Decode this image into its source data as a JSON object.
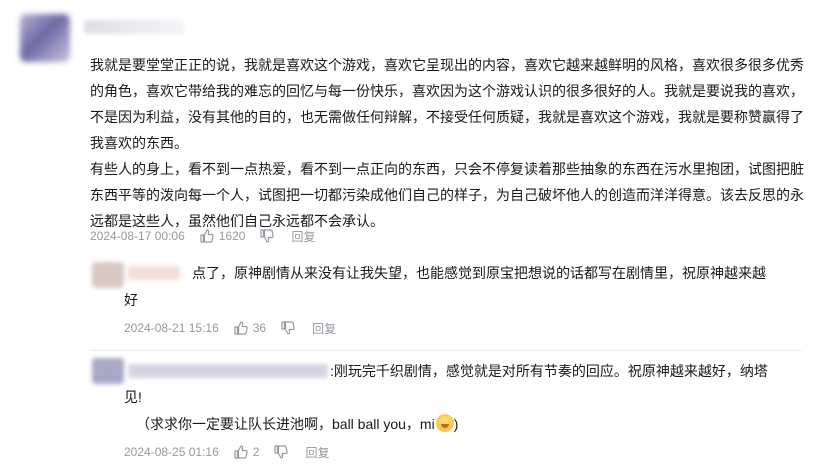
{
  "main_comment": {
    "paragraphs": [
      "我就是要堂堂正正的说，我就是喜欢这个游戏，喜欢它呈现出的内容，喜欢它越来越鲜明的风格，喜欢很多很多优秀的角色，喜欢它带给我的难忘的回忆与每一份快乐，喜欢因为这个游戏认识的很多很好的人。我就是要说我的喜欢，不是因为利益，没有其他的目的，也无需做任何辩解，不接受任何质疑，我就是喜欢这个游戏，我就是要称赞赢得了我喜欢的东西。",
      "有些人的身上，看不到一点热爱，看不到一点正向的东西，只会不停复读着那些抽象的东西在污水里抱团，试图把脏东西平等的泼向每一个人，试图把一切都污染成他们自己的样子，为自己破坏他人的创造而洋洋得意。该去反思的永远都是这些人，虽然他们自己永远都不会承认。"
    ],
    "time": "2024-08-17 00:06",
    "likes": "1620",
    "reply_label": "回复"
  },
  "replies": [
    {
      "lines": [
        "点了，原神剧情从来没有让我失望，也能感觉到原宝把想说的话都写在剧情里，祝原神越来越",
        "好"
      ],
      "time": "2024-08-21 15:16",
      "likes": "36",
      "reply_label": "回复",
      "avatar_color": "#d9c9c2",
      "name_color": "#f2dfd6"
    },
    {
      "lines": [
        ":刚玩完千织剧情，感觉就是对所有节奏的回应。祝原神越来越好，纳塔",
        "见!",
        "（求求你一定要让队长进池啊，ball ball you，mi"
      ],
      "emoji_tail": ")",
      "time": "2024-08-25 01:16",
      "likes": "2",
      "reply_label": "回复",
      "avatar_color": "#a9a9c7",
      "name_color": "#d6d3e4"
    }
  ],
  "icons": {
    "like": "thumbs-up-icon",
    "dislike": "thumbs-down-icon",
    "emoji": "blush-emoji-icon"
  }
}
